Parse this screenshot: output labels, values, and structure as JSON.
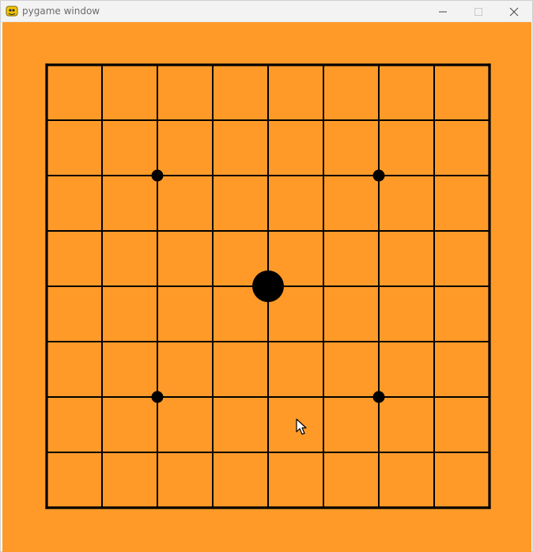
{
  "window": {
    "title": "pygame window",
    "app_icon": "pygame-snake-icon",
    "controls": [
      "minimize-icon",
      "maximize-icon",
      "close-icon"
    ]
  },
  "board": {
    "background_color": "#ff9a28",
    "line_color": "#000000",
    "lines": 9,
    "star_points": [
      [
        2,
        2
      ],
      [
        6,
        2
      ],
      [
        2,
        6
      ],
      [
        6,
        6
      ]
    ],
    "stones": [
      {
        "col": 4,
        "row": 4,
        "color": "#000000"
      }
    ]
  }
}
